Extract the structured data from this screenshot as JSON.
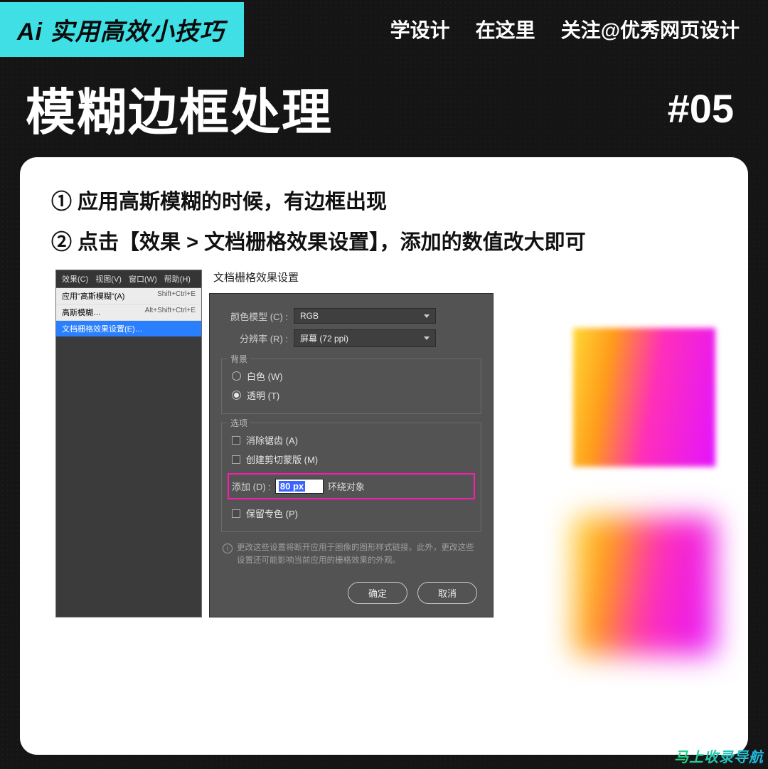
{
  "banner": {
    "left": "Ai 实用高效小技巧",
    "right1": "学设计",
    "right2": "在这里",
    "right3": "关注@优秀网页设计"
  },
  "title": "模糊边框处理",
  "hash": "#05",
  "steps": {
    "s1": "① 应用高斯模糊的时候，有边框出现",
    "s2": "② 点击【效果 > 文档栅格效果设置】，添加的数值改大即可"
  },
  "menu": {
    "bar": {
      "effect": "效果(C)",
      "view": "视图(V)",
      "window": "窗口(W)",
      "help": "帮助(H)"
    },
    "row1": {
      "label": "应用\"高斯模糊\"(A)",
      "kbd": "Shift+Ctrl+E"
    },
    "row2": {
      "label": "高斯模糊…",
      "kbd": "Alt+Shift+Ctrl+E"
    },
    "row3": {
      "label": "文档栅格效果设置(E)…",
      "kbd": ""
    }
  },
  "dialog": {
    "title": "文档栅格效果设置",
    "colorModel": {
      "label": "颜色模型 (C) :",
      "value": "RGB"
    },
    "resolution": {
      "label": "分辨率 (R) :",
      "value": "屏幕 (72 ppi)"
    },
    "bgGroup": "背景",
    "bgWhite": "白色 (W)",
    "bgTransparent": "透明 (T)",
    "optGroup": "选项",
    "antialias": "消除锯齿 (A)",
    "clipMask": "创建剪切蒙版 (M)",
    "addLabel": "添加 (D) :",
    "addValue": "80 px",
    "addSuffix": "环绕对象",
    "preserveSpot": "保留专色 (P)",
    "info": "更改这些设置将断开应用于图像的图形样式链接。此外，更改这些设置还可能影响当前应用的栅格效果的外观。",
    "ok": "确定",
    "cancel": "取消"
  },
  "watermark": "马上收录导航"
}
